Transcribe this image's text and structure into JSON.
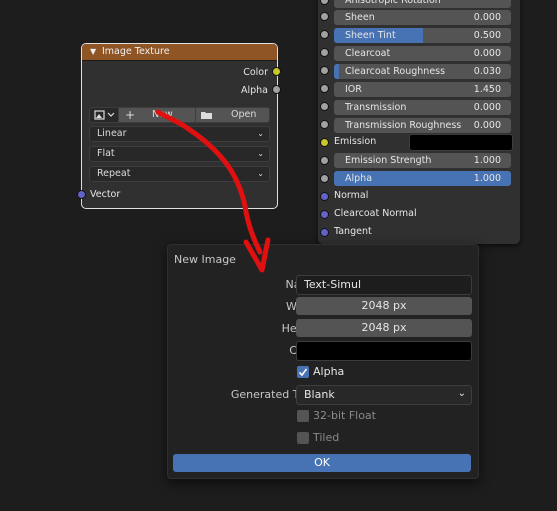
{
  "bsdf_node": {
    "top_cut_label": "Anisotropic Rotation",
    "rows": [
      {
        "label": "Sheen",
        "value": "0.000",
        "fill": 0
      },
      {
        "label": "Sheen Tint",
        "value": "0.500",
        "fill": 0.5
      },
      {
        "label": "Clearcoat",
        "value": "0.000",
        "fill": 0
      },
      {
        "label": "Clearcoat Roughness",
        "value": "0.030",
        "fill": 0.03
      },
      {
        "label": "IOR",
        "value": "1.450",
        "fill": 0
      },
      {
        "label": "Transmission",
        "value": "0.000",
        "fill": 0
      },
      {
        "label": "Transmission Roughness",
        "value": "0.000",
        "fill": 0
      },
      {
        "label": "Emission",
        "value": "",
        "fill": 0
      },
      {
        "label": "Emission Strength",
        "value": "1.000",
        "fill": 0
      },
      {
        "label": "Alpha",
        "value": "1.000",
        "fill": 1
      }
    ],
    "emission_color": "#000000",
    "plain_inputs": [
      "Normal",
      "Clearcoat Normal",
      "Tangent"
    ]
  },
  "image_texture_node": {
    "title": "Image Texture",
    "outputs": [
      "Color",
      "Alpha"
    ],
    "new_label": "New",
    "open_label": "Open",
    "interpolation": "Linear",
    "projection": "Flat",
    "extension": "Repeat",
    "vector_label": "Vector"
  },
  "new_image_dialog": {
    "title": "New Image",
    "name_label": "Name",
    "name_value": "Text-Simul",
    "width_label": "Width",
    "width_value": "2048 px",
    "height_label": "Height",
    "height_value": "2048 px",
    "color_label": "Color",
    "color_value": "#000000",
    "alpha_label": "Alpha",
    "alpha_checked": true,
    "generated_type_label": "Generated Type",
    "generated_type_value": "Blank",
    "float_label": "32-bit Float",
    "float_checked": false,
    "tiled_label": "Tiled",
    "tiled_checked": false,
    "ok_label": "OK"
  },
  "colors": {
    "accent": "#4772b3",
    "node_header": "#8f5525",
    "annotation_arrow": "#e01010"
  }
}
